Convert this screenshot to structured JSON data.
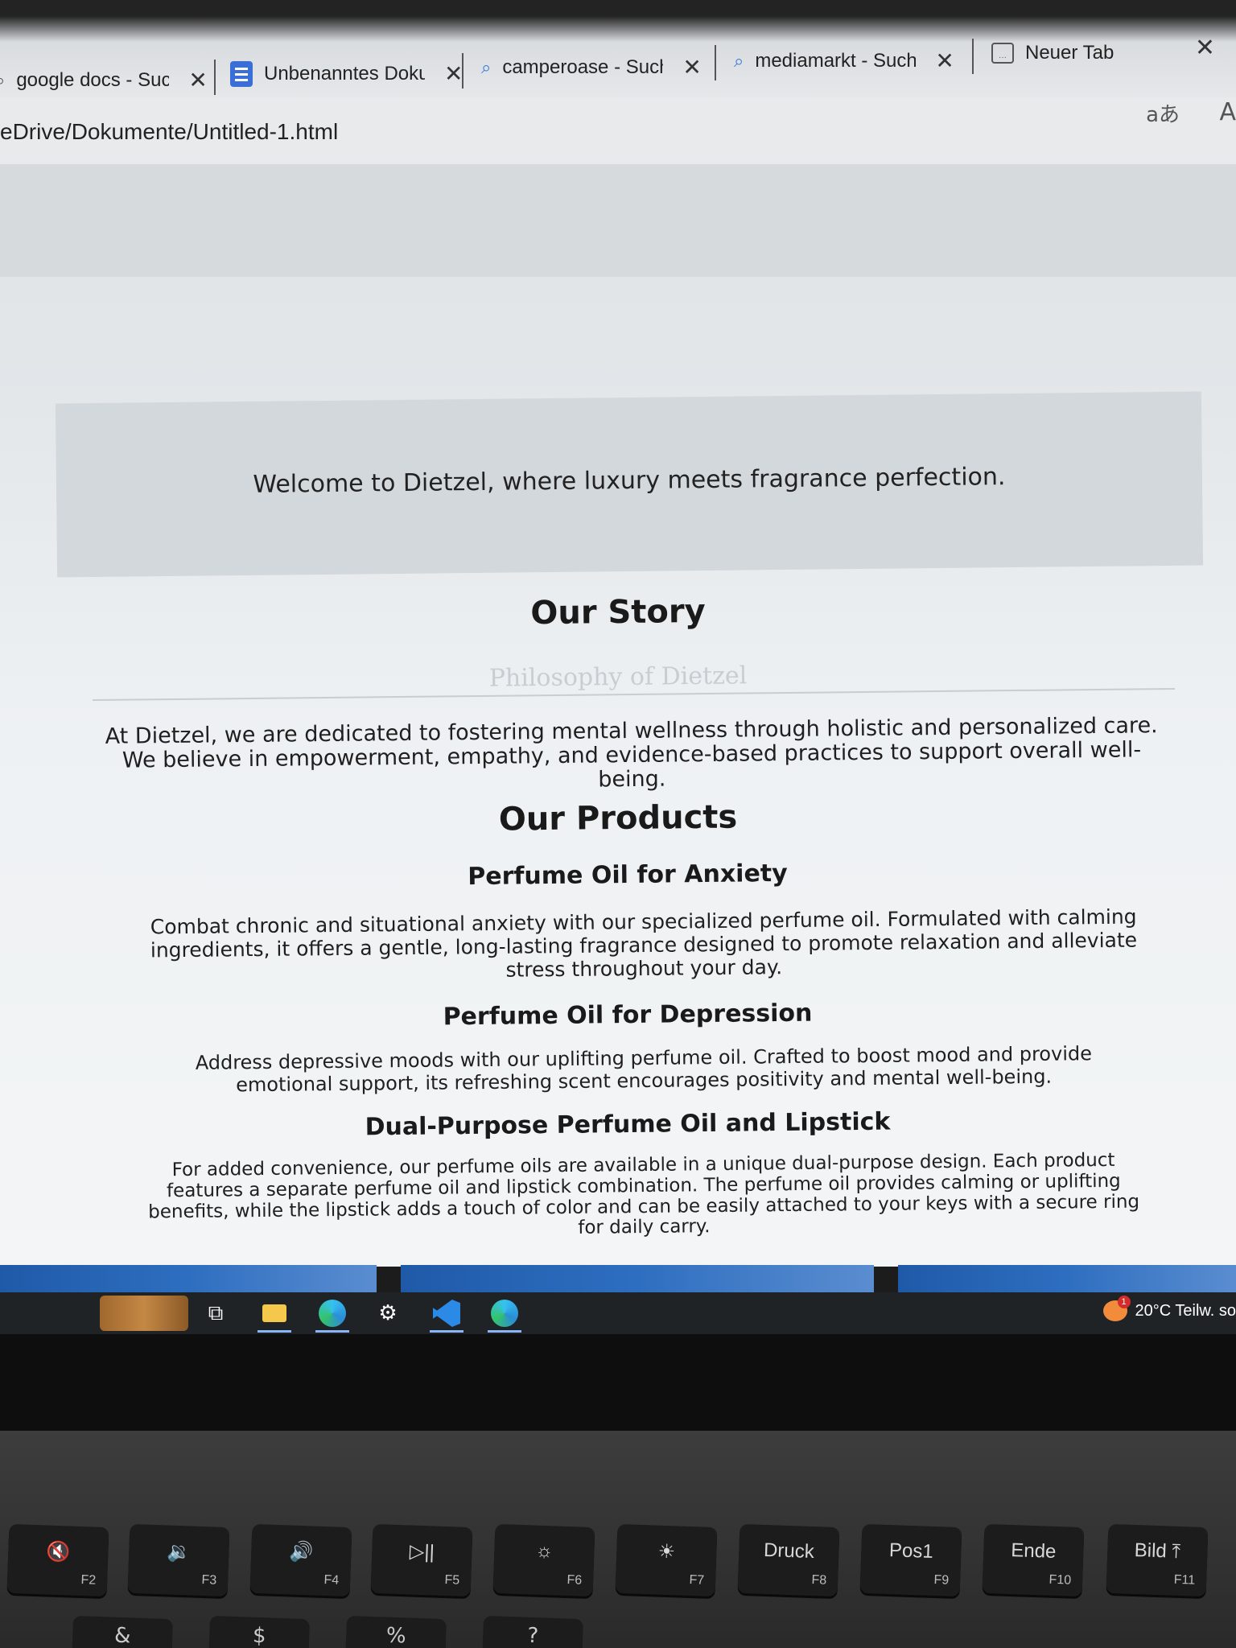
{
  "browser": {
    "tabs": [
      {
        "title": "google docs - Suc",
        "icon": "search-icon"
      },
      {
        "title": "Unbenanntes Doku",
        "icon": "docs-icon"
      },
      {
        "title": "camperoase - Such",
        "icon": "search-icon"
      },
      {
        "title": "mediamarkt - Such",
        "icon": "search-icon"
      },
      {
        "title": "Neuer Tab",
        "icon": "new-tab-icon"
      }
    ],
    "close_symbol": "✕",
    "url": "eDrive/Dokumente/Untitled-1.html",
    "translate_label": "aあ",
    "read_aloud_label": "A"
  },
  "page": {
    "welcome": "Welcome to Dietzel, where luxury meets fragrance perfection.",
    "story_title": "Our Story",
    "philosophy": "Philosophy of Dietzel",
    "story_text": "At Dietzel, we are dedicated to fostering mental wellness through holistic and personalized care. We believe in empowerment, empathy, and evidence-based practices to support overall well-being.",
    "products_title": "Our Products",
    "products": [
      {
        "title": "Perfume Oil for Anxiety",
        "text": "Combat chronic and situational anxiety with our specialized perfume oil. Formulated with calming ingredients, it offers a gentle, long-lasting fragrance designed to promote relaxation and alleviate stress throughout your day."
      },
      {
        "title": "Perfume Oil for Depression",
        "text": "Address depressive moods with our uplifting perfume oil. Crafted to boost mood and provide emotional support, its refreshing scent encourages positivity and mental well-being."
      },
      {
        "title": "Dual-Purpose Perfume Oil and Lipstick",
        "text": "For added convenience, our perfume oils are available in a unique dual-purpose design. Each product features a separate perfume oil and lipstick combination. The perfume oil provides calming or uplifting benefits, while the lipstick adds a touch of color and can be easily attached to your keys with a secure ring for daily carry."
      }
    ]
  },
  "taskbar": {
    "weather_text": "20°C  Teilw. so",
    "weather_badge": "1"
  },
  "keyboard": {
    "keys": [
      {
        "label": "🔇",
        "fn": "F2"
      },
      {
        "label": "🔉",
        "fn": "F3"
      },
      {
        "label": "🔊",
        "fn": "F4"
      },
      {
        "label": "▷||",
        "fn": "F5"
      },
      {
        "label": "☼",
        "fn": "F6"
      },
      {
        "label": "☀",
        "fn": "F7"
      },
      {
        "label": "Druck",
        "fn": "F8"
      },
      {
        "label": "Pos1",
        "fn": "F9"
      },
      {
        "label": "Ende",
        "fn": "F10"
      },
      {
        "label": "Bild ⤒",
        "fn": "F11"
      }
    ],
    "row2": [
      "&",
      "$",
      "%",
      "?"
    ]
  }
}
